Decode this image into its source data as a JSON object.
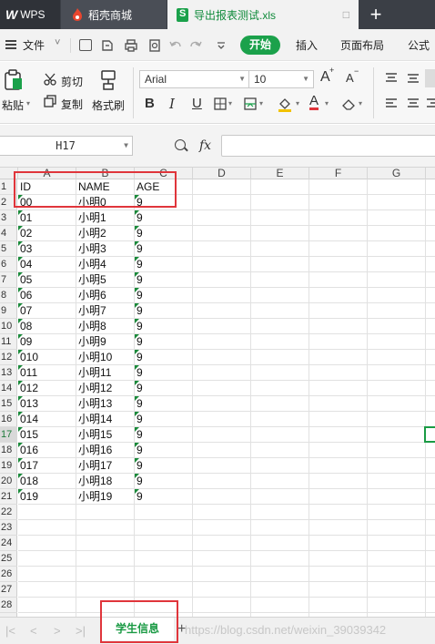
{
  "tabs": {
    "wps_logo": "W",
    "wps_label": "WPS",
    "shell_label": "稻壳商城",
    "doc_label": "导出报表测试.xls",
    "close_symbol": "□",
    "new_tab_symbol": "+"
  },
  "menubar": {
    "file_label": "文件",
    "file_arrow": "˅",
    "start_label": "开始",
    "insert_label": "插入",
    "page_layout_label": "页面布局",
    "formula_label": "公式"
  },
  "ribbon": {
    "paste_label": "粘贴",
    "cut_label": "剪切",
    "copy_label": "复制",
    "format_painter_label": "格式刷",
    "font_name": "Arial",
    "font_size": "10",
    "bold": "B",
    "italic": "I",
    "underline": "U",
    "grow_font": "A",
    "shrink_font": "A",
    "font_color": "A"
  },
  "formula_bar": {
    "name_box": "H17",
    "fx_label": "fx",
    "formula_value": ""
  },
  "grid": {
    "columns": [
      "A",
      "B",
      "C",
      "D",
      "E",
      "F",
      "G"
    ],
    "row_numbers": [
      "1",
      "2",
      "3",
      "4",
      "5",
      "6",
      "7",
      "8",
      "9",
      "10",
      "11",
      "12",
      "13",
      "14",
      "15",
      "16",
      "17",
      "18",
      "19",
      "20",
      "21",
      "22",
      "23",
      "24",
      "25",
      "26",
      "27",
      "28"
    ],
    "active_row": "17",
    "header_row": [
      "ID",
      "NAME",
      "AGE"
    ],
    "rows": [
      [
        "00",
        "小明0",
        "9"
      ],
      [
        "01",
        "小明1",
        "9"
      ],
      [
        "02",
        "小明2",
        "9"
      ],
      [
        "03",
        "小明3",
        "9"
      ],
      [
        "04",
        "小明4",
        "9"
      ],
      [
        "05",
        "小明5",
        "9"
      ],
      [
        "06",
        "小明6",
        "9"
      ],
      [
        "07",
        "小明7",
        "9"
      ],
      [
        "08",
        "小明8",
        "9"
      ],
      [
        "09",
        "小明9",
        "9"
      ],
      [
        "010",
        "小明10",
        "9"
      ],
      [
        "011",
        "小明11",
        "9"
      ],
      [
        "012",
        "小明12",
        "9"
      ],
      [
        "013",
        "小明13",
        "9"
      ],
      [
        "014",
        "小明14",
        "9"
      ],
      [
        "015",
        "小明15",
        "9"
      ],
      [
        "016",
        "小明16",
        "9"
      ],
      [
        "017",
        "小明17",
        "9"
      ],
      [
        "018",
        "小明18",
        "9"
      ],
      [
        "019",
        "小明19",
        "9"
      ]
    ]
  },
  "sheets": {
    "active_sheet": "学生信息",
    "add_symbol": "+",
    "nav_first": "|<",
    "nav_prev": "<",
    "nav_next": ">",
    "nav_last": ">|",
    "watermark": "https://blog.csdn.net/weixin_39039342"
  },
  "colors": {
    "accent_green": "#1ba14b",
    "highlight_red": "#e0353b",
    "titlebar_dark": "#3b3f46"
  }
}
